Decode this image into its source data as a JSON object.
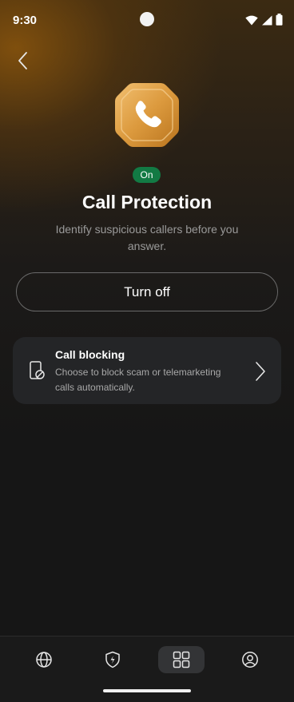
{
  "status_bar": {
    "time": "9:30",
    "icons": [
      "wifi-icon",
      "cellular-signal-icon",
      "battery-icon"
    ]
  },
  "header": {
    "back_icon": "chevron-left-icon"
  },
  "feature": {
    "icon": "phone-shield-icon",
    "status_badge": "On",
    "title": "Call Protection",
    "description": "Identify suspicious callers before you answer.",
    "primary_action": "Turn off"
  },
  "settings": [
    {
      "icon": "phone-block-icon",
      "title": "Call blocking",
      "description": "Choose to block scam or telemarketing calls automatically.",
      "trailing_icon": "chevron-right-icon"
    }
  ],
  "bottom_nav": {
    "items": [
      {
        "icon": "globe-icon",
        "active": false
      },
      {
        "icon": "shield-bolt-icon",
        "active": false
      },
      {
        "icon": "grid-icon",
        "active": true
      },
      {
        "icon": "account-icon",
        "active": false
      }
    ]
  },
  "colors": {
    "accent_orange": "#e0a04a",
    "badge_green": "#127a44",
    "background": "#161616",
    "card": "#242527"
  }
}
